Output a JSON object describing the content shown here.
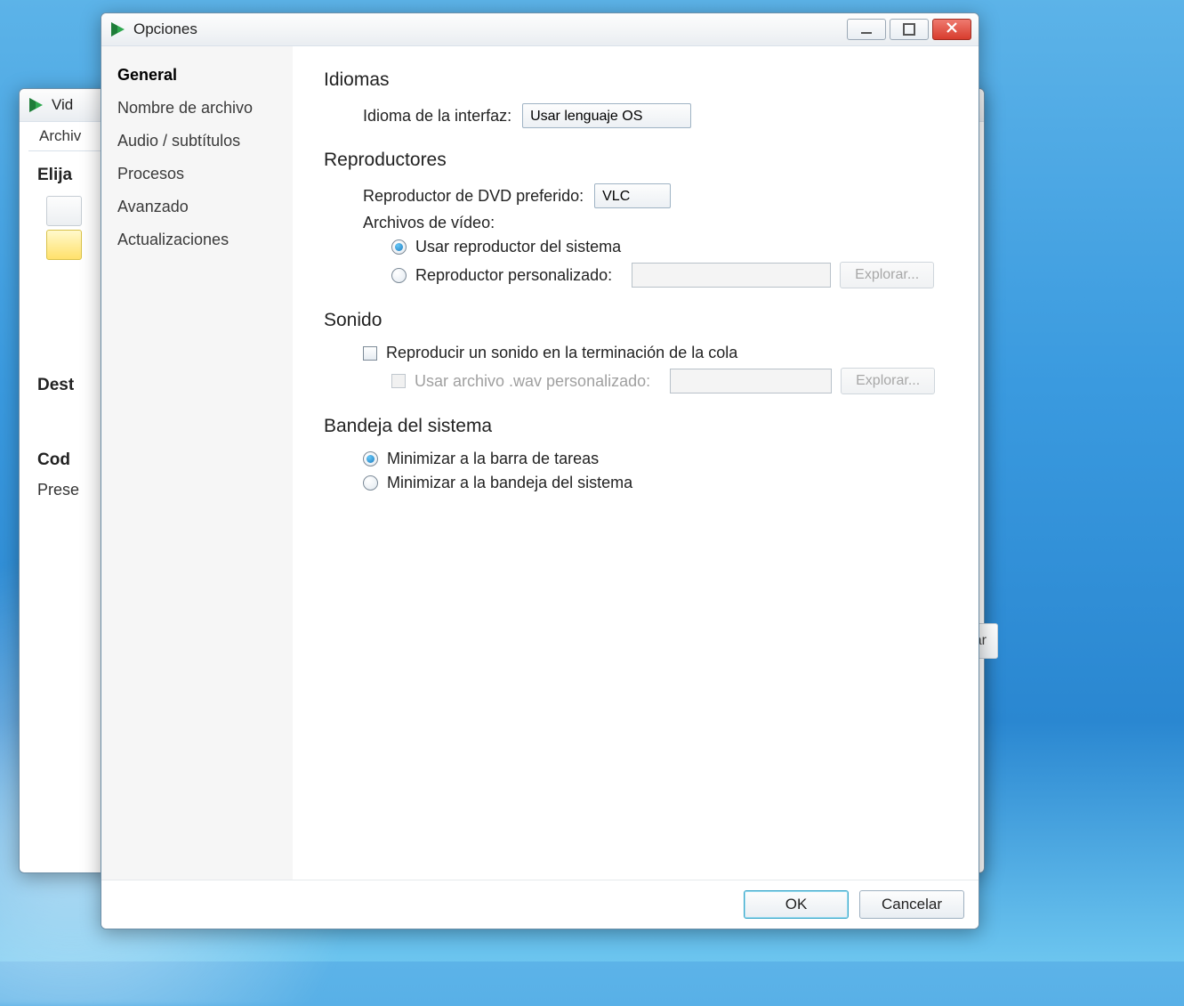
{
  "bg_window": {
    "title_fragment": "Vid",
    "menu_item": "Archiv",
    "section_choose": "Elija",
    "section_dest": "Dest",
    "section_cod": "Cod",
    "label_preset": "Prese",
    "far_button_fragment": "ficar"
  },
  "dialog": {
    "title": "Opciones",
    "sidebar": {
      "items": [
        "General",
        "Nombre de archivo",
        "Audio / subtítulos",
        "Procesos",
        "Avanzado",
        "Actualizaciones"
      ],
      "selected": 0
    },
    "sections": {
      "lang": {
        "title": "Idiomas",
        "label": "Idioma de la interfaz:",
        "value": "Usar lenguaje OS"
      },
      "players": {
        "title": "Reproductores",
        "dvd_label": "Reproductor de DVD preferido:",
        "dvd_value": "VLC",
        "video_files_label": "Archivos de vídeo:",
        "radio_system": "Usar reproductor del sistema",
        "radio_custom": "Reproductor personalizado:",
        "browse": "Explorar..."
      },
      "sound": {
        "title": "Sonido",
        "chk_play": "Reproducir un sonido en la terminación de la cola",
        "chk_wav": "Usar archivo .wav personalizado:",
        "browse": "Explorar..."
      },
      "tray": {
        "title": "Bandeja del sistema",
        "radio_taskbar": "Minimizar a la barra de tareas",
        "radio_tray": "Minimizar a la bandeja del sistema"
      }
    },
    "footer": {
      "ok": "OK",
      "cancel": "Cancelar"
    }
  }
}
